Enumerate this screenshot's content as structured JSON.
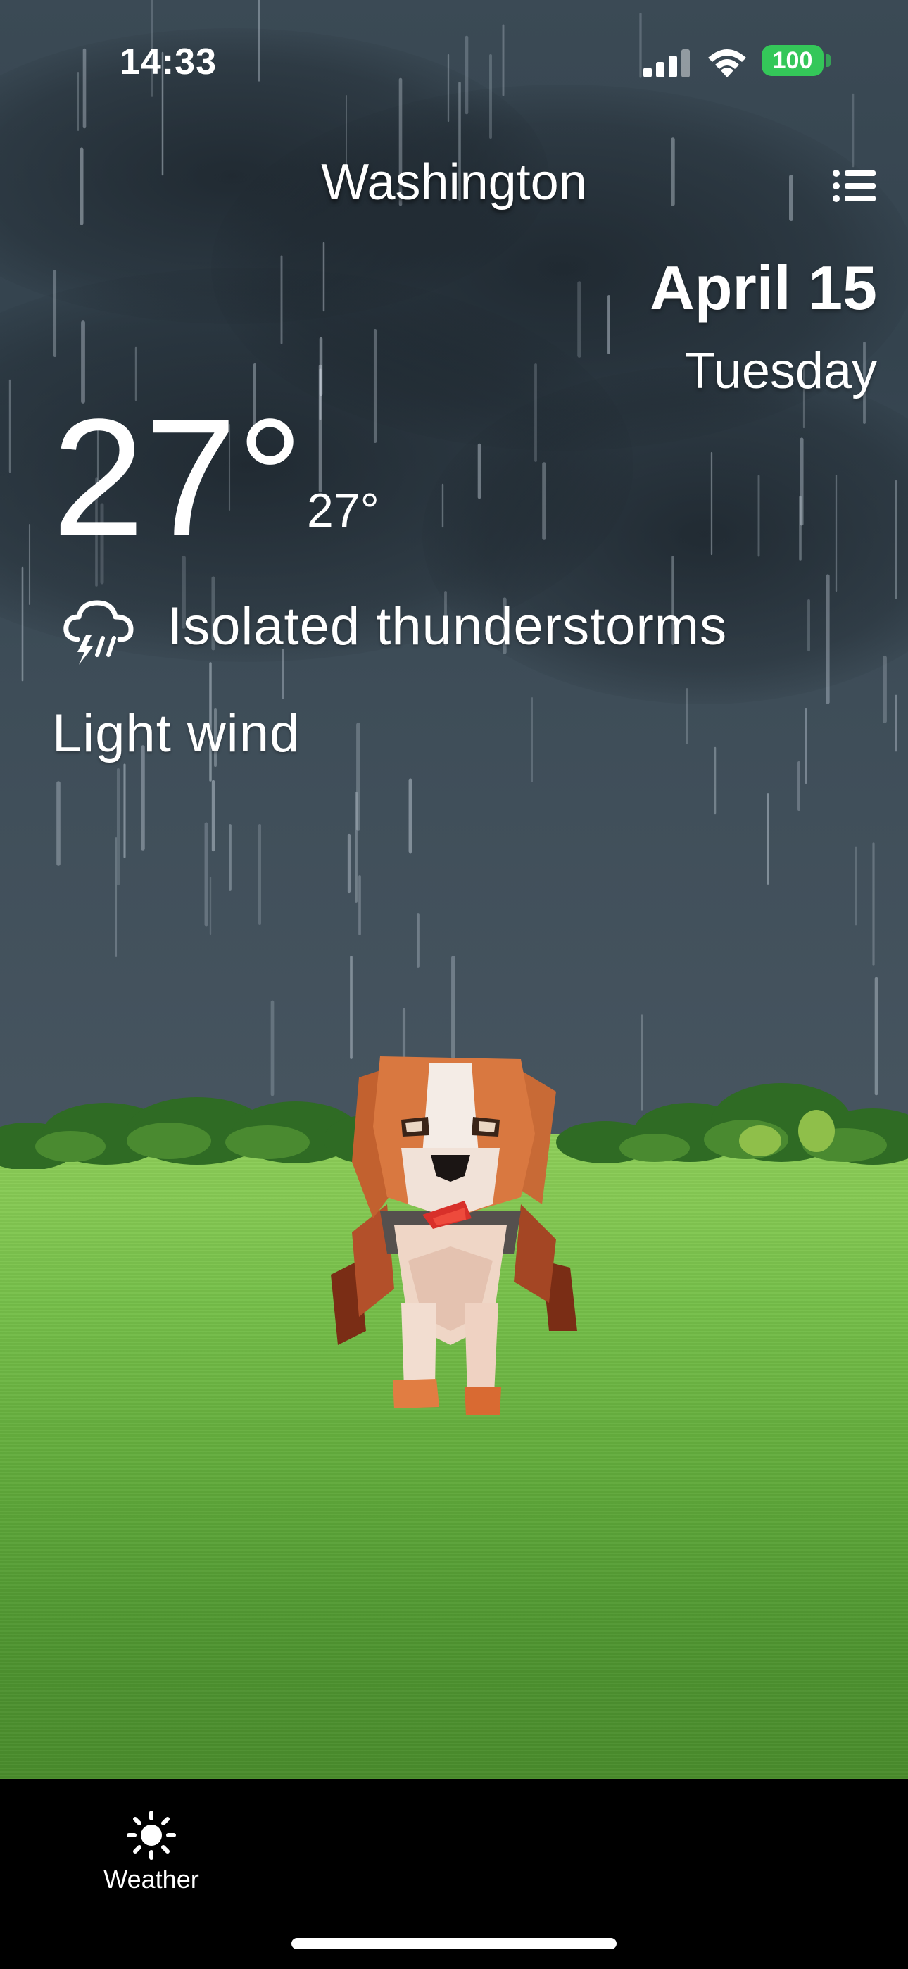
{
  "status_bar": {
    "time": "14:33",
    "battery": "100",
    "battery_color": "#34c759"
  },
  "header": {
    "city": "Washington",
    "menu_icon": "list-icon",
    "date": "April 15",
    "weekday": "Tuesday"
  },
  "current": {
    "temperature": "27°",
    "feels_like": "27°",
    "condition": "Isolated thunderstorms",
    "condition_icon": "thunderstorm-cloud-icon",
    "wind": "Light wind"
  },
  "tab_bar": {
    "items": [
      {
        "label": "Weather",
        "icon": "sun-icon"
      }
    ]
  }
}
